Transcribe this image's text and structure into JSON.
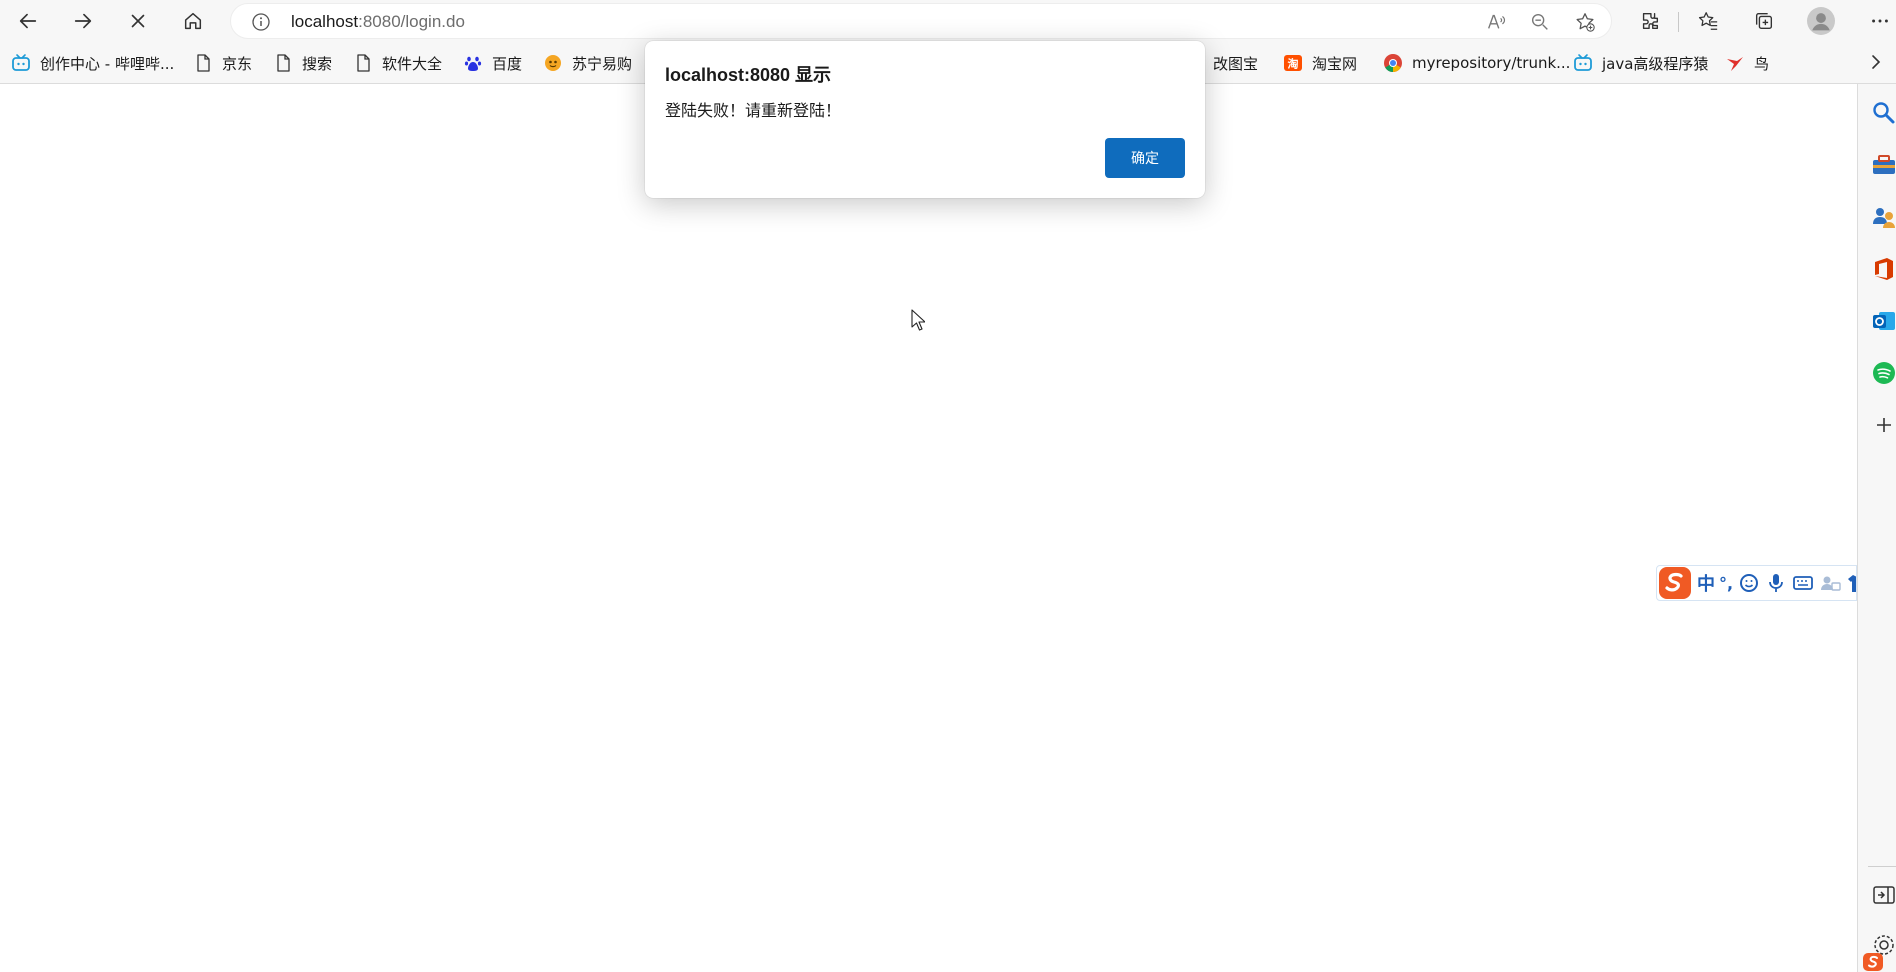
{
  "browser": {
    "address": {
      "host": "localhost",
      "path": ":8080/login.do"
    }
  },
  "bookmarks": [
    {
      "label": "创作中心 - 哔哩哔...",
      "icon": "bilibili-icon"
    },
    {
      "label": "京东",
      "icon": "page-icon"
    },
    {
      "label": "搜索",
      "icon": "page-icon"
    },
    {
      "label": "软件大全",
      "icon": "page-icon"
    },
    {
      "label": "百度",
      "icon": "baidu-paw-icon"
    },
    {
      "label": "苏宁易购",
      "icon": "suning-icon"
    },
    {
      "label": "改图宝",
      "icon": "page-icon"
    },
    {
      "label": "淘宝网",
      "icon": "taobao-icon"
    },
    {
      "label": "myrepository/trunk...",
      "icon": "chrome-icon"
    },
    {
      "label": "java高级程序猿",
      "icon": "bilibili-icon"
    },
    {
      "label": "鸟",
      "icon": "bird-icon"
    }
  ],
  "dialog": {
    "title": "localhost:8080 显示",
    "message": "登陆失败！请重新登陆！",
    "ok_label": "确定"
  },
  "ime": {
    "mode": "中",
    "punct": "°,"
  },
  "colors": {
    "accent": "#0f6cbd",
    "chrome_bg": "#f7f7f7"
  }
}
